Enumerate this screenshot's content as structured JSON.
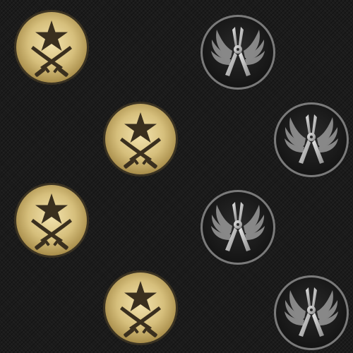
{
  "wallpaper": {
    "background_color": "#1b1b1b",
    "emblems": [
      {
        "icon": "counter-terrorist-emblem-icon",
        "faction": "counter-terrorist",
        "color": "#c9b26f"
      },
      {
        "icon": "counter-terrorist-emblem-icon",
        "faction": "counter-terrorist",
        "color": "#c9b26f"
      },
      {
        "icon": "counter-terrorist-emblem-icon",
        "faction": "counter-terrorist",
        "color": "#c9b26f"
      },
      {
        "icon": "counter-terrorist-emblem-icon",
        "faction": "counter-terrorist",
        "color": "#c9b26f"
      },
      {
        "icon": "terrorist-emblem-icon",
        "faction": "terrorist",
        "color": "#bdbdbd"
      },
      {
        "icon": "terrorist-emblem-icon",
        "faction": "terrorist",
        "color": "#bdbdbd"
      },
      {
        "icon": "terrorist-emblem-icon",
        "faction": "terrorist",
        "color": "#bdbdbd"
      },
      {
        "icon": "terrorist-emblem-icon",
        "faction": "terrorist",
        "color": "#bdbdbd"
      }
    ]
  }
}
